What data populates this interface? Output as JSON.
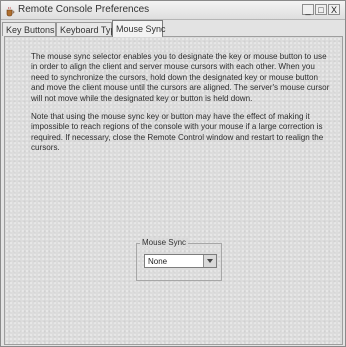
{
  "window": {
    "title": "Remote Console Preferences",
    "controls": {
      "minimize": "_",
      "maximize": "□",
      "close": "X"
    },
    "icon": "java-coffee-icon"
  },
  "tabs": [
    {
      "label": "Key Buttons",
      "active": false
    },
    {
      "label": "Keyboard Type",
      "active": false
    },
    {
      "label": "Mouse Sync",
      "active": true
    }
  ],
  "panel": {
    "paragraph1": "The mouse sync selector enables you to designate the key or mouse button to use in order to align the client and server mouse cursors with each other.  When you need to synchronize the cursors, hold down the designated key or mouse button and move the client mouse until the cursors are aligned.  The server's mouse cursor will not move while the designated key or button is held down.",
    "paragraph2": "Note that using the mouse sync key or button may have the effect of making it impossible to reach regions of the console with your mouse if a large correction is required.  If necessary, close the Remote Control window and restart to realign the cursors.",
    "mouse_sync": {
      "group_label": "Mouse Sync",
      "selected": "None",
      "arrow_icon": "chevron-down-icon"
    }
  }
}
